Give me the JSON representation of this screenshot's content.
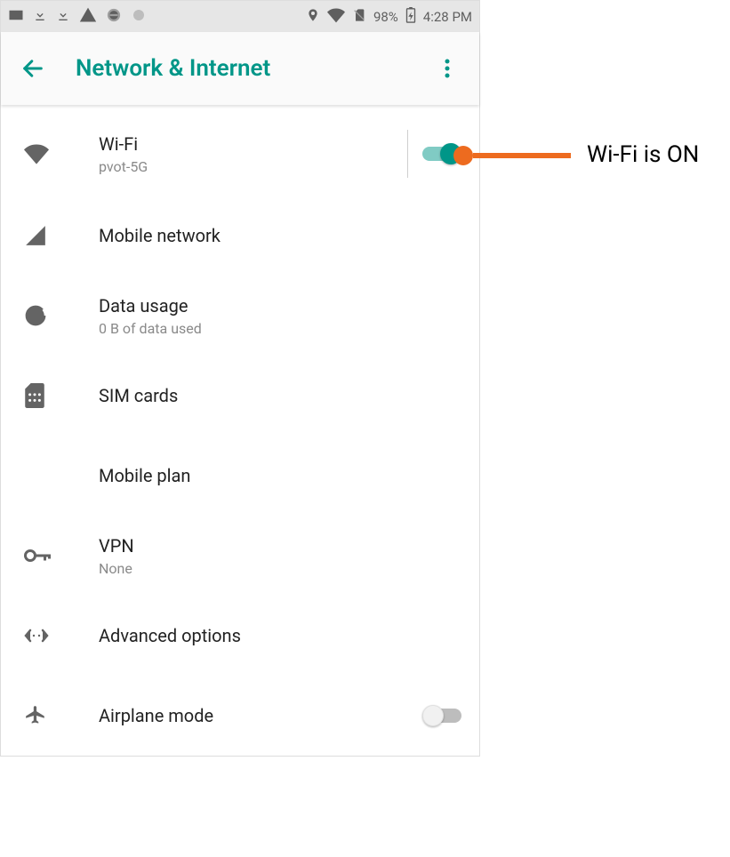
{
  "statusbar": {
    "battery": "98%",
    "time": "4:28 PM"
  },
  "appbar": {
    "title": "Network & Internet"
  },
  "items": {
    "wifi": {
      "title": "Wi-Fi",
      "sub": "pvot-5G",
      "toggle_on": true
    },
    "mobile_network": {
      "title": "Mobile network"
    },
    "data_usage": {
      "title": "Data usage",
      "sub": "0 B of data used"
    },
    "sim_cards": {
      "title": "SIM cards"
    },
    "mobile_plan": {
      "title": "Mobile plan"
    },
    "vpn": {
      "title": "VPN",
      "sub": "None"
    },
    "advanced": {
      "title": "Advanced options"
    },
    "airplane": {
      "title": "Airplane mode",
      "toggle_on": false
    }
  },
  "annotation": {
    "text": "Wi-Fi is ON"
  }
}
